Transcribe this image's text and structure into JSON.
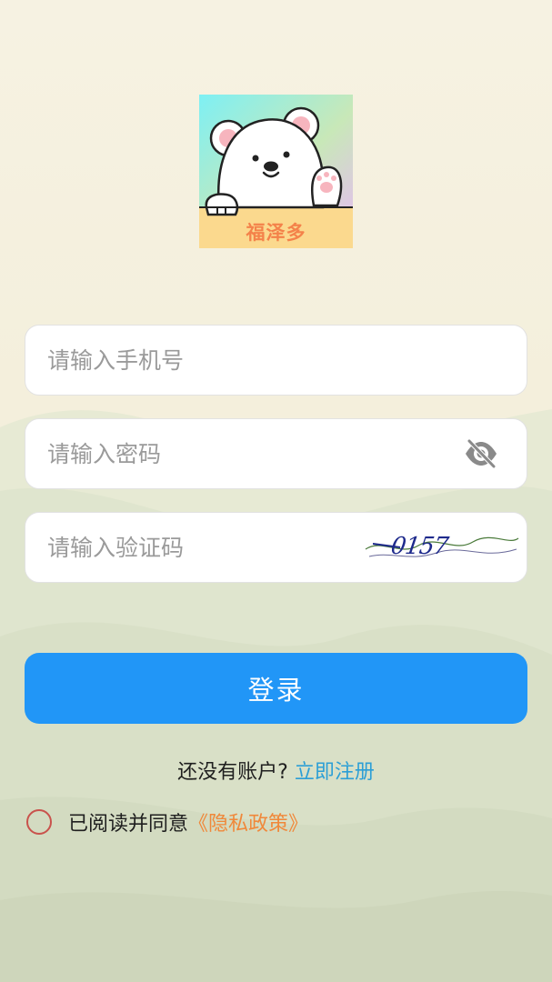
{
  "logo": {
    "text": "福泽多",
    "background_top": "#7ef0f4",
    "background_right": "#e8b8f7",
    "band_color": "#fbd98e",
    "text_color": "#f4824a"
  },
  "form": {
    "phone_placeholder": "请输入手机号",
    "password_placeholder": "请输入密码",
    "code_placeholder": "请输入验证码",
    "captcha_text": "0157",
    "password_toggle_icon": "eye-slash-icon"
  },
  "login_button": {
    "label": "登录",
    "color": "#2196f7"
  },
  "register": {
    "prompt": "还没有账户?",
    "link": "立即注册"
  },
  "agreement": {
    "text": "已阅读并同意",
    "policy_link": "《隐私政策》",
    "checked": false
  }
}
